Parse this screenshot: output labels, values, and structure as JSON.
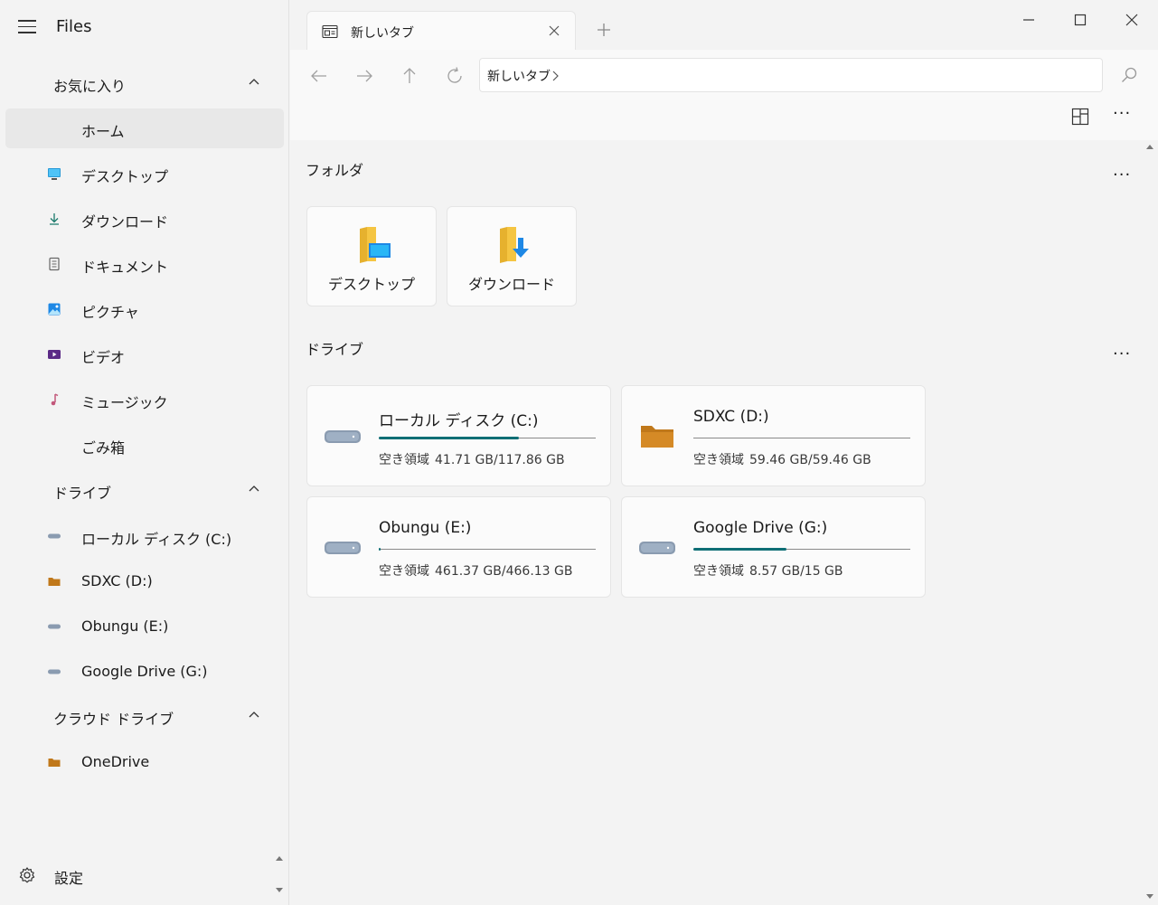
{
  "app": {
    "title": "Files"
  },
  "sidebar": {
    "favorites": {
      "header": "お気に入り",
      "items": [
        {
          "label": "ホーム",
          "icon": "home-icon"
        },
        {
          "label": "デスクトップ",
          "icon": "desktop-icon"
        },
        {
          "label": "ダウンロード",
          "icon": "download-icon"
        },
        {
          "label": "ドキュメント",
          "icon": "document-icon"
        },
        {
          "label": "ピクチャ",
          "icon": "pictures-icon"
        },
        {
          "label": "ビデオ",
          "icon": "videos-icon"
        },
        {
          "label": "ミュージック",
          "icon": "music-icon"
        },
        {
          "label": "ごみ箱",
          "icon": "recycle-bin-icon"
        }
      ]
    },
    "drives": {
      "header": "ドライブ",
      "items": [
        {
          "label": "ローカル ディスク (C:)",
          "icon": "drive-icon"
        },
        {
          "label": "SDXC (D:)",
          "icon": "folder-drive-icon"
        },
        {
          "label": "Obungu (E:)",
          "icon": "drive-icon"
        },
        {
          "label": "Google Drive (G:)",
          "icon": "drive-icon"
        }
      ]
    },
    "cloud": {
      "header": "クラウド ドライブ",
      "items": [
        {
          "label": "OneDrive",
          "icon": "folder-drive-icon"
        }
      ]
    },
    "settings_label": "設定"
  },
  "tab": {
    "label": "新しいタブ"
  },
  "address": {
    "crumb": "新しいタブ"
  },
  "folders": {
    "title": "フォルダ",
    "items": [
      {
        "label": "デスクトップ"
      },
      {
        "label": "ダウンロード"
      }
    ]
  },
  "drives_section": {
    "title": "ドライブ",
    "free_label": "空き領域",
    "items": [
      {
        "name": "ローカル ディスク (C:)",
        "free": "41.71 GB/117.86 GB",
        "used_fraction": 0.646
      },
      {
        "name": "SDXC (D:)",
        "free": "59.46 GB/59.46 GB",
        "used_fraction": 0.0
      },
      {
        "name": "Obungu (E:)",
        "free": "461.37 GB/466.13 GB",
        "used_fraction": 0.01
      },
      {
        "name": "Google Drive (G:)",
        "free": "8.57 GB/15 GB",
        "used_fraction": 0.43
      }
    ]
  },
  "colors": {
    "accent": "#0e6e75",
    "folder": "#f5c542",
    "drive": "#8a9bb0",
    "sd_folder": "#c0781a"
  }
}
